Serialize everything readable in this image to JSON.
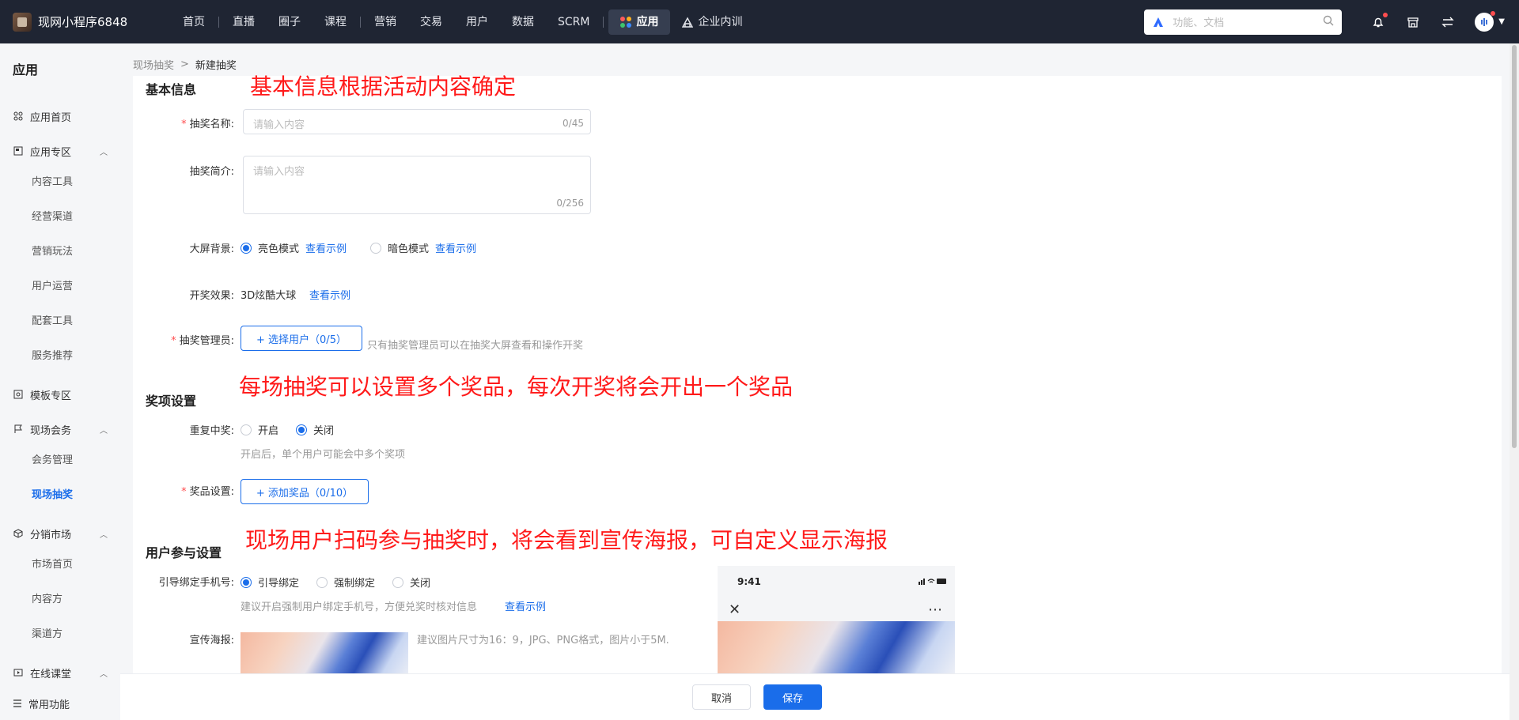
{
  "header": {
    "brand": "现网小程序6848",
    "nav": [
      "首页",
      "直播",
      "圈子",
      "课程",
      "营销",
      "交易",
      "用户",
      "数据",
      "SCRM"
    ],
    "active_nav": "应用",
    "extra_nav": "企业内训",
    "search_placeholder": "功能、文档"
  },
  "sidebar": {
    "title": "应用",
    "items": {
      "app_home": "应用首页",
      "app_zone": "应用专区",
      "content_tools": "内容工具",
      "channels": "经营渠道",
      "marketing": "营销玩法",
      "user_ops": "用户运营",
      "support_tools": "配套工具",
      "service_rec": "服务推荐",
      "template_zone": "模板专区",
      "onsite": "现场会务",
      "meeting_mgmt": "会务管理",
      "onsite_lottery": "现场抽奖",
      "distribution": "分销市场",
      "market_home": "市场首页",
      "content_side": "内容方",
      "channel_side": "渠道方",
      "online_class": "在线课堂",
      "common": "常用功能"
    }
  },
  "breadcrumb": {
    "parent": "现场抽奖",
    "sep": ">",
    "current": "新建抽奖"
  },
  "form": {
    "basic": {
      "title": "基本信息",
      "annotation": "基本信息根据活动内容确定",
      "name_label": "抽奖名称:",
      "name_placeholder": "请输入内容",
      "name_count": "0/45",
      "intro_label": "抽奖简介:",
      "intro_placeholder": "请输入内容",
      "intro_count": "0/256",
      "bg_label": "大屏背景:",
      "bg_light": "亮色模式",
      "bg_dark": "暗色模式",
      "view_example": "查看示例",
      "effect_label": "开奖效果:",
      "effect_value": "3D炫酷大球",
      "admin_label": "抽奖管理员:",
      "admin_button": "+ 选择用户（0/5）",
      "admin_hint": "只有抽奖管理员可以在抽奖大屏查看和操作开奖"
    },
    "prize": {
      "title": "奖项设置",
      "annotation": "每场抽奖可以设置多个奖品，每次开奖将会开出一个奖品",
      "repeat_label": "重复中奖:",
      "repeat_on": "开启",
      "repeat_off": "关闭",
      "repeat_hint": "开启后，单个用户可能会中多个奖项",
      "prize_label": "奖品设置:",
      "prize_button": "+ 添加奖品（0/10）"
    },
    "participate": {
      "title": "用户参与设置",
      "annotation": "现场用户扫码参与抽奖时，将会看到宣传海报，可自定义显示海报",
      "phone_label": "引导绑定手机号:",
      "phone_guide": "引导绑定",
      "phone_force": "强制绑定",
      "phone_off": "关闭",
      "phone_hint": "建议开启强制用户绑定手机号，方便兑奖时核对信息",
      "poster_label": "宣传海报:",
      "poster_hint": "建议图片尺寸为16：9，JPG、PNG格式，图片小于5M.",
      "preview_time": "9:41"
    }
  },
  "footer": {
    "cancel": "取消",
    "save": "保存"
  },
  "colors": {
    "primary": "#1a6dea",
    "annotation": "#ff1a1a",
    "topbar": "#1f2533"
  }
}
